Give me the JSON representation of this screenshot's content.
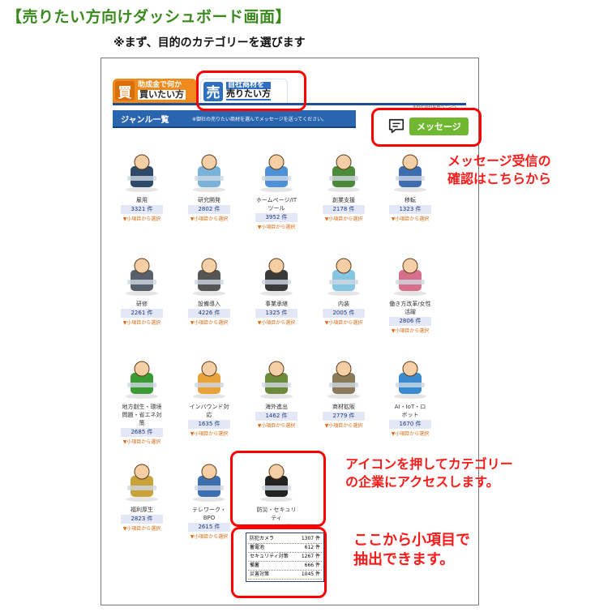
{
  "page_title": "【売りたい方向けダッシュボード画面】",
  "subtitle": "※まず、目的のカテゴリーを選びます",
  "tabs": {
    "buy": {
      "badge": "買",
      "line1": "助成金で何か",
      "line2": "買いたい方"
    },
    "sell": {
      "badge": "売",
      "line1": "自社商材を",
      "line2": "売りたい方"
    }
  },
  "tiny_note": "※自社商材専用ページへ",
  "genre_bar": {
    "title": "ジャンル一覧",
    "note": "※御社の売りたい商材を選んでメッセージを送ってください。"
  },
  "message_button": {
    "label": "メッセージ",
    "icon": "chat-bubble-icon"
  },
  "sub_select_label": "▼小項目から選択",
  "categories": [
    {
      "name": "雇用",
      "count": "3321 件",
      "icon": "business-meeting-icon"
    },
    {
      "name": "研究開発",
      "count": "2802 件",
      "icon": "microscope-researcher-icon"
    },
    {
      "name": "ホームページ/IT\nツール",
      "count": "3952 件",
      "icon": "computer-monitor-icon"
    },
    {
      "name": "創業支援",
      "count": "2178 件",
      "icon": "entrepreneur-sprout-icon"
    },
    {
      "name": "移転",
      "count": "1323 件",
      "icon": "moving-truck-icon"
    },
    {
      "name": "研修",
      "count": "2261 件",
      "icon": "training-seminar-icon"
    },
    {
      "name": "設備導入",
      "count": "4226 件",
      "icon": "factory-icon"
    },
    {
      "name": "事業承継",
      "count": "1325 件",
      "icon": "president-desk-icon"
    },
    {
      "name": "内装",
      "count": "2005 件",
      "icon": "interior-wallpaper-icon"
    },
    {
      "name": "働き方改革/女性\n活躍",
      "count": "2806 件",
      "icon": "working-mother-icon"
    },
    {
      "name": "地方創生・環境\n問題・省エネ対\n策",
      "count": "2685 件",
      "icon": "japan-map-icon"
    },
    {
      "name": "インバウンド対\n応",
      "count": "1635 件",
      "icon": "tourists-icon"
    },
    {
      "name": "海外進出",
      "count": "1462 件",
      "icon": "world-map-icon"
    },
    {
      "name": "商材拡販",
      "count": "2779 件",
      "icon": "temple-market-icon"
    },
    {
      "name": "AI・IoT・ロ\nボット",
      "count": "1670 件",
      "icon": "robot-icon"
    },
    {
      "name": "福利厚生",
      "count": "2823 件",
      "icon": "auditorium-icon"
    },
    {
      "name": "テレワーク・\nBPO",
      "count": "2615 件",
      "icon": "telework-person-icon"
    },
    {
      "name": "防災・セキュリ\nティ",
      "count": "",
      "icon": "security-camera-icon"
    }
  ],
  "active_sub_label": "▲小項目から選択",
  "subitems": [
    {
      "name": "防犯カメラ",
      "count": "1307 件"
    },
    {
      "name": "蓄電池",
      "count": "612 件"
    },
    {
      "name": "セキュリティ対策",
      "count": "1267 件"
    },
    {
      "name": "備蓄",
      "count": "666 件"
    },
    {
      "name": "災害対策",
      "count": "1045 件"
    }
  ],
  "callouts": {
    "message": "メッセージ受信の\n確認はこちらから",
    "icon": "アイコンを押してカテゴリー\nの企業にアクセスします。",
    "subitems": "ここから小項目で\n抽出できます。"
  },
  "colors": {
    "title_green": "#3b8a1e",
    "callout_red": "#ff1a1a",
    "buy_orange": "#f08a1c",
    "sell_blue": "#2f6fc1",
    "message_green": "#70b832",
    "sub_select_orange": "#e06b12"
  }
}
